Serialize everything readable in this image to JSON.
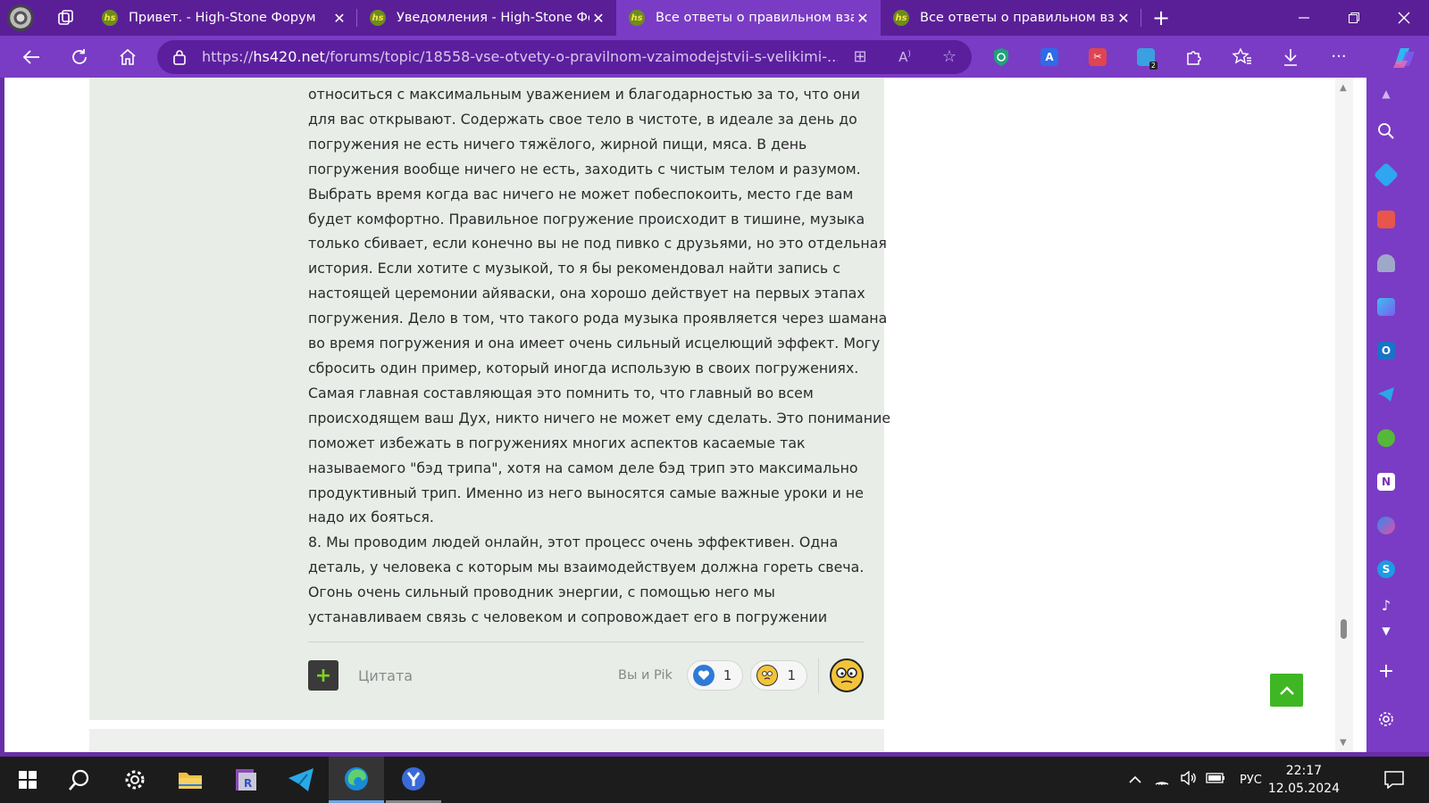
{
  "tabs": [
    {
      "title": "Привет. - High-Stone Форум",
      "active": false
    },
    {
      "title": "Уведомления - High-Stone Форум",
      "active": false
    },
    {
      "title": "Все ответы о правильном взаимодействии",
      "active": true
    },
    {
      "title": "Все ответы о правильном взаимодействии",
      "active": false
    }
  ],
  "favicon_text": "hs",
  "address": {
    "prefix": "https://",
    "domain": "hs420.net",
    "path": "/forums/topic/18558-vse-otvety-o-pravilnom-vzaimodejstvii-s-velikimi-..."
  },
  "post": {
    "lines": [
      "относиться с максимальным уважением и благодарностью за то, что они",
      "для вас открывают. Содержать свое тело в чистоте, в идеале за день до",
      "погружения не есть ничего тяжёлого, жирной пищи, мяса. В день",
      "погружения вообще ничего не есть, заходить с чистым телом и разумом.",
      "Выбрать время когда вас ничего не может побеспокоить, место где вам",
      "будет комфортно. Правильное погружение происходит в тишине, музыка",
      "только сбивает, если конечно вы не под пивко с друзьями, но это отдельная",
      "история. Если хотите с музыкой, то я бы рекомендовал найти запись с",
      "настоящей церемонии айяваски, она хорошо действует на первых этапах",
      "погружения. Дело в том, что такого рода музыка проявляется через шамана",
      "во время погружения и она имеет очень сильный исцелющий эффект. Могу",
      "сбросить один пример, который иногда использую в своих погружениях.",
      "Самая главная составляющая это помнить то, что главный во всем",
      "происходящем ваш Дух, никто ничего не может ему сделать. Это понимание",
      "поможет избежать в погружениях многих аспектов касаемые так",
      "называемого \"бэд трипа\", хотя на самом деле бэд трип это максимально",
      "продуктивный трип. Именно из него выносятся самые важные уроки и не",
      "надо их бояться.",
      "8. Мы проводим людей онлайн, этот процесс очень эффективен. Одна",
      "деталь, у человека с которым мы взаимодействуем должна гореть свеча.",
      "Огонь очень сильный проводник энергии, с помощью него мы",
      "устанавливаем связь с человеком и сопровождает его в погружении"
    ],
    "footer": {
      "add_label": "+",
      "quote_label": "Цитата",
      "reacted_by": "Вы и Pik",
      "reactions": [
        {
          "icon": "heart-icon",
          "count": "1"
        },
        {
          "icon": "confused-emoji-icon",
          "count": "1"
        }
      ]
    }
  },
  "taskbar": {
    "language": "РУС",
    "time": "22:17",
    "date": "12.05.2024"
  },
  "colors": {
    "browser_accent": "#7a3cc4",
    "tab_strip": "#5a1f97",
    "post_background": "#e8ede8",
    "scroll_top_button": "#3fb624"
  }
}
